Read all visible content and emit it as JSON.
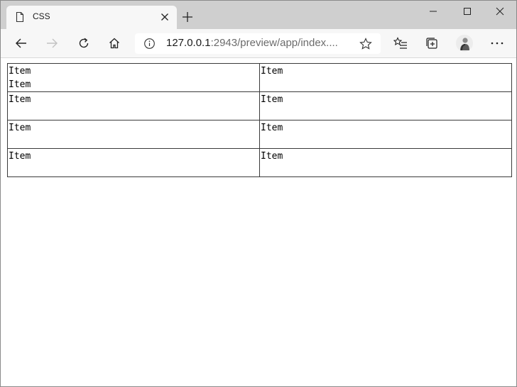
{
  "browser": {
    "tab_title": "CSS",
    "address": {
      "host": "127.0.0.1",
      "rest": ":2943/preview/app/index...."
    },
    "icons": {
      "tab": "page-icon",
      "close": "close-icon",
      "new_tab": "plus-icon",
      "back": "back-arrow-icon",
      "forward": "forward-arrow-icon",
      "refresh": "refresh-icon",
      "home": "home-icon",
      "info": "info-icon",
      "favorite": "star-icon",
      "favorites_list": "favorites-list-icon",
      "collections": "collections-icon",
      "profile": "profile-avatar",
      "more": "more-icon"
    }
  },
  "page": {
    "grid": [
      [
        "Item",
        "Item"
      ],
      [
        "Item"
      ],
      [
        "Item"
      ],
      [
        "Item"
      ],
      [
        "Item"
      ],
      [
        "Item"
      ],
      [
        "Item"
      ],
      [
        "Item"
      ]
    ]
  }
}
